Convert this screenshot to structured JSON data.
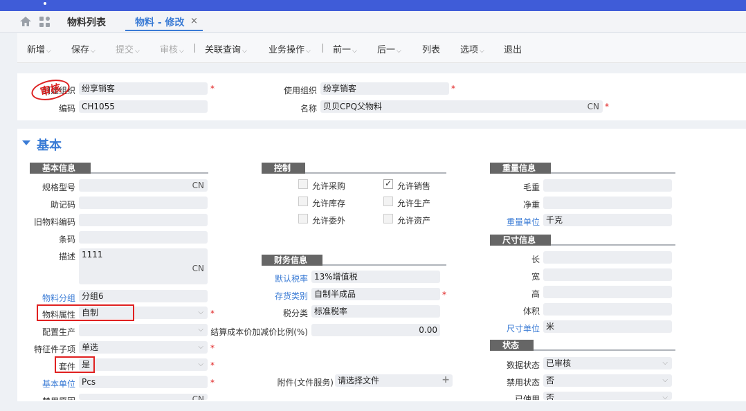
{
  "tabs": {
    "list": "物料列表",
    "edit": "物料 - 修改",
    "close": "×"
  },
  "toolbar": {
    "new": "新增",
    "save": "保存",
    "submit": "提交",
    "audit": "审核",
    "related": "关联查询",
    "business": "业务操作",
    "prev": "前一",
    "next": "后一",
    "list": "列表",
    "options": "选项",
    "exit": "退出",
    "caret": "⌵"
  },
  "header": {
    "stamp": "审核",
    "create_org_label": "创建组织",
    "create_org": "纷享销客",
    "code_label": "编码",
    "code": "CH1055",
    "use_org_label": "使用组织",
    "use_org": "纷享销客",
    "name_label": "名称",
    "name": "贝贝CPQ父物料",
    "cn": "CN"
  },
  "section_title": "基本",
  "basic": {
    "title": "基本信息",
    "spec_label": "规格型号",
    "spec_cn": "CN",
    "mnemonic_label": "助记码",
    "old_code_label": "旧物料编码",
    "barcode_label": "条码",
    "desc_label": "描述",
    "desc": "1111",
    "desc_cn": "CN",
    "group_label": "物料分组",
    "group": "分组6",
    "attr_label": "物料属性",
    "attr": "自制",
    "config_label": "配置生产",
    "feature_label": "特征件子项",
    "feature": "单选",
    "kit_label": "套件",
    "kit": "是",
    "unit_label": "基本单位",
    "unit": "Pcs",
    "cut_label": "禁用原因",
    "cut_cn": "CN"
  },
  "control": {
    "title": "控制",
    "allow_purchase": "允许采购",
    "allow_sale": "允许销售",
    "allow_stock": "允许库存",
    "allow_produce": "允许生产",
    "allow_outsource": "允许委外",
    "allow_asset": "允许资产"
  },
  "finance": {
    "title": "财务信息",
    "tax_rate_label": "默认税率",
    "tax_rate": "13%增值税",
    "stock_cat_label": "存货类别",
    "stock_cat": "自制半成品",
    "tax_class_label": "税分类",
    "tax_class": "标准税率",
    "cost_label": "结算成本价加减价比例(%)",
    "cost": "0.00"
  },
  "attachment": {
    "label": "附件(文件服务)",
    "value": "请选择文件",
    "plus": "+"
  },
  "weight": {
    "title": "重量信息",
    "gross_label": "毛重",
    "net_label": "净重",
    "unit_label": "重量单位",
    "unit": "千克"
  },
  "size": {
    "title": "尺寸信息",
    "length_label": "长",
    "width_label": "宽",
    "height_label": "高",
    "volume_label": "体积",
    "unit_label": "尺寸单位",
    "unit": "米"
  },
  "status": {
    "title": "状态",
    "data_label": "数据状态",
    "data": "已审核",
    "forbid_label": "禁用状态",
    "forbid": "否",
    "used_label": "已使用",
    "used": "否"
  },
  "chev": "⌵",
  "req": "*"
}
